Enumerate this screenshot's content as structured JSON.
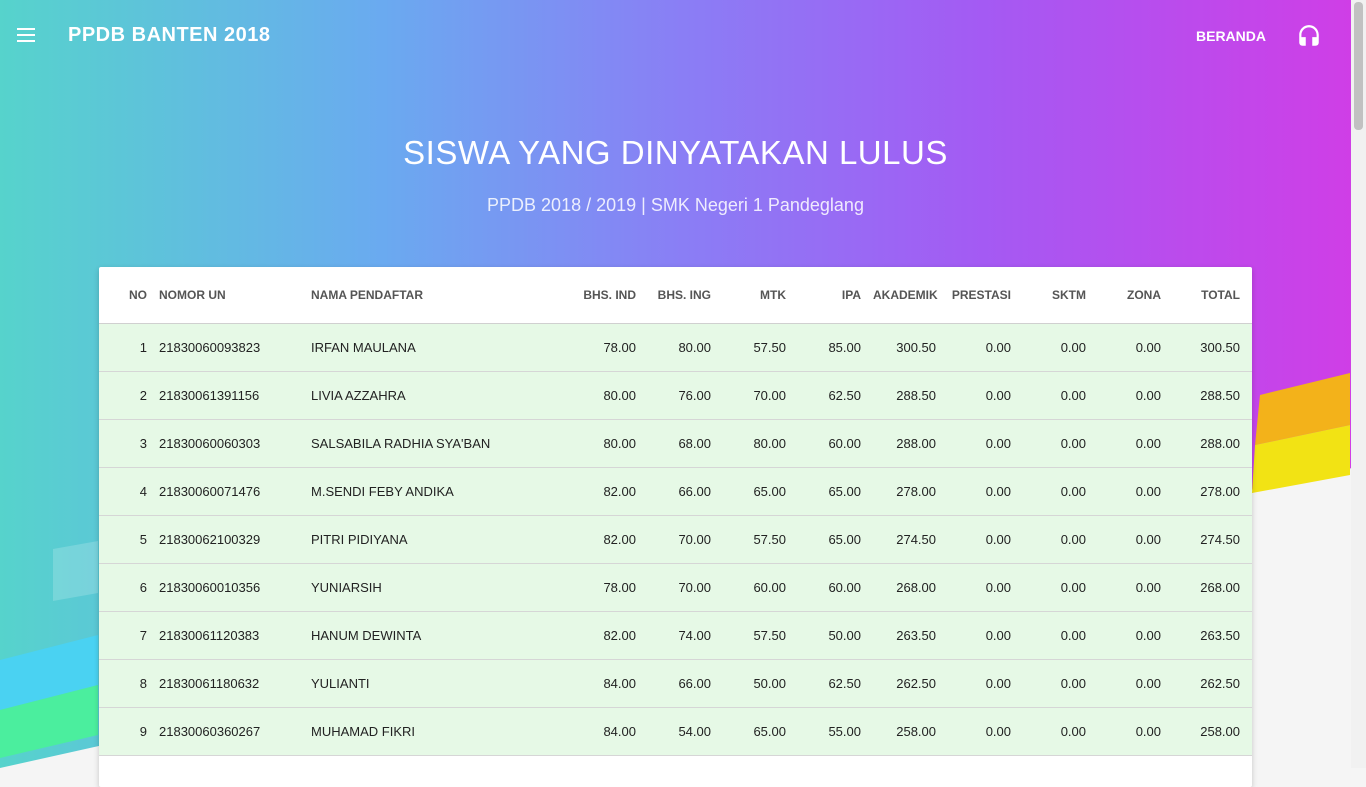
{
  "navbar": {
    "brand": "PPDB BANTEN 2018",
    "beranda": "BERANDA",
    "menu_icon": "menu-icon",
    "support_icon": "headset-icon"
  },
  "header": {
    "title": "SISWA YANG DINYATAKAN LULUS",
    "subtitle": "PPDB 2018 / 2019 | SMK Negeri 1 Pandeglang"
  },
  "table": {
    "columns": [
      "NO",
      "NOMOR UN",
      "NAMA PENDAFTAR",
      "BHS. IND",
      "BHS. ING",
      "MTK",
      "IPA",
      "AKADEMIK",
      "PRESTASI",
      "SKTM",
      "ZONA",
      "TOTAL"
    ],
    "rows": [
      [
        "1",
        "21830060093823",
        "IRFAN MAULANA",
        "78.00",
        "80.00",
        "57.50",
        "85.00",
        "300.50",
        "0.00",
        "0.00",
        "0.00",
        "300.50"
      ],
      [
        "2",
        "21830061391156",
        "LIVIA AZZAHRA",
        "80.00",
        "76.00",
        "70.00",
        "62.50",
        "288.50",
        "0.00",
        "0.00",
        "0.00",
        "288.50"
      ],
      [
        "3",
        "21830060060303",
        "SALSABILA RADHIA SYA'BAN",
        "80.00",
        "68.00",
        "80.00",
        "60.00",
        "288.00",
        "0.00",
        "0.00",
        "0.00",
        "288.00"
      ],
      [
        "4",
        "21830060071476",
        "M.SENDI FEBY ANDIKA",
        "82.00",
        "66.00",
        "65.00",
        "65.00",
        "278.00",
        "0.00",
        "0.00",
        "0.00",
        "278.00"
      ],
      [
        "5",
        "21830062100329",
        "PITRI PIDIYANA",
        "82.00",
        "70.00",
        "57.50",
        "65.00",
        "274.50",
        "0.00",
        "0.00",
        "0.00",
        "274.50"
      ],
      [
        "6",
        "21830060010356",
        "YUNIARSIH",
        "78.00",
        "70.00",
        "60.00",
        "60.00",
        "268.00",
        "0.00",
        "0.00",
        "0.00",
        "268.00"
      ],
      [
        "7",
        "21830061120383",
        "HANUM DEWINTA",
        "82.00",
        "74.00",
        "57.50",
        "50.00",
        "263.50",
        "0.00",
        "0.00",
        "0.00",
        "263.50"
      ],
      [
        "8",
        "21830061180632",
        "YULIANTI",
        "84.00",
        "66.00",
        "50.00",
        "62.50",
        "262.50",
        "0.00",
        "0.00",
        "0.00",
        "262.50"
      ],
      [
        "9",
        "21830060360267",
        "MUHAMAD FIKRI",
        "84.00",
        "54.00",
        "65.00",
        "55.00",
        "258.00",
        "0.00",
        "0.00",
        "0.00",
        "258.00"
      ]
    ]
  },
  "colors": {
    "row_bg": "#e6f9e6",
    "header_gradient": [
      "#56d3cc",
      "#6aaaf0",
      "#8a7ef5",
      "#a45af3",
      "#d13de6"
    ]
  }
}
